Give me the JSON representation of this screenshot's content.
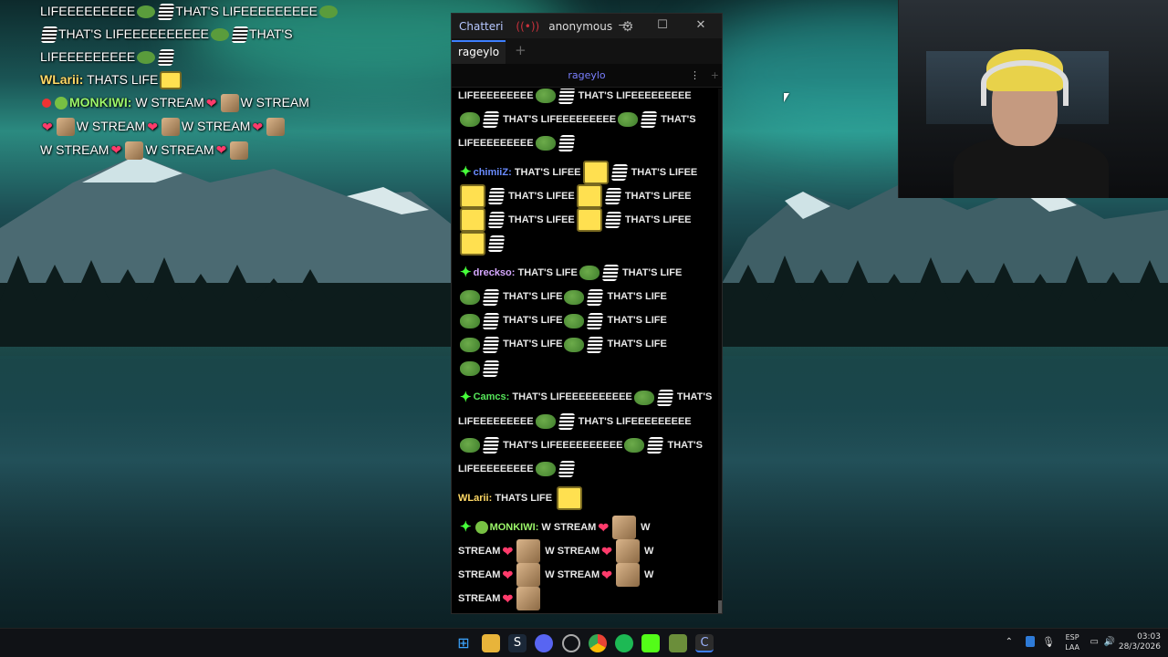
{
  "overlay_chat": {
    "lines": [
      {
        "parts": [
          "LIFEEEEEEEEE",
          "THAT'S LIFEEEEEEEEE"
        ]
      },
      {
        "parts": [
          "THAT'S LIFEEEEEEEEEE",
          "THAT'S"
        ]
      },
      {
        "parts": [
          "LIFEEEEEEEEE"
        ]
      },
      {
        "user": "WLarii",
        "user_color": "#ffd966",
        "text": "THATS LIFE"
      },
      {
        "user": "MONKIWI",
        "user_color": "#9cf76a",
        "parts": [
          "W STREAM",
          "W STREAM"
        ]
      },
      {
        "parts": [
          "W STREAM",
          "W STREAM"
        ]
      },
      {
        "parts": [
          "W STREAM",
          "W STREAM"
        ]
      }
    ]
  },
  "chatterino": {
    "app_title": "Chatteri",
    "account": "anonymous",
    "tab": "rageylo",
    "split_title": "rageylo",
    "messages": [
      {
        "type": "continuation",
        "segments": [
          "LIFEEEEEEEEE",
          "THAT'S LIFEEEEEEEEE",
          "THAT'S LIFEEEEEEEEE",
          "THAT'S",
          "LIFEEEEEEEEE"
        ]
      },
      {
        "type": "chat",
        "user": "chimiiZ",
        "user_color": "#6a8cff",
        "segments": [
          "THAT'S LIFEE",
          "THAT'S LIFEE",
          "THAT'S LIFEE",
          "THAT'S LIFEE",
          "THAT'S LIFEE",
          "THAT'S LIFEE"
        ]
      },
      {
        "type": "chat",
        "user": "drecksо",
        "user_color": "#d6a8ff",
        "segments": [
          "THAT'S LIFE",
          "THAT'S LIFE",
          "THAT'S LIFE",
          "THAT'S LIFE",
          "THAT'S LIFE",
          "THAT'S LIFE",
          "THAT'S LIFE",
          "THAT'S LIFE"
        ]
      },
      {
        "type": "chat",
        "user": "Camcs",
        "user_color": "#56e65a",
        "segments": [
          "THAT'S LIFEEEEEEEEEE",
          "THAT'S",
          "LIFEEEEEEEEE",
          "THAT'S LIFEEEEEEEEE",
          "THAT'S LIFEEEEEEEEEE",
          "THAT'S",
          "LIFEEEEEEEEE"
        ]
      },
      {
        "type": "chat",
        "user": "WLarii",
        "user_color": "#ffd966",
        "segments": [
          "THATS LIFE"
        ]
      },
      {
        "type": "chat",
        "user": "MONKIWI",
        "user_color": "#9cf76a",
        "segments": [
          "W STREAM",
          "W",
          "STREAM",
          "W STREAM",
          "W",
          "STREAM",
          "W STREAM",
          "W",
          "STREAM"
        ]
      }
    ]
  },
  "taskbar": {
    "lang_top": "ESP",
    "lang_bottom": "LAA",
    "time": "03:03",
    "date": "28/3/2026"
  },
  "colors": {
    "accent": "#3d7fff",
    "window_bg": "#000000",
    "taskbar_bg": "#101216"
  }
}
